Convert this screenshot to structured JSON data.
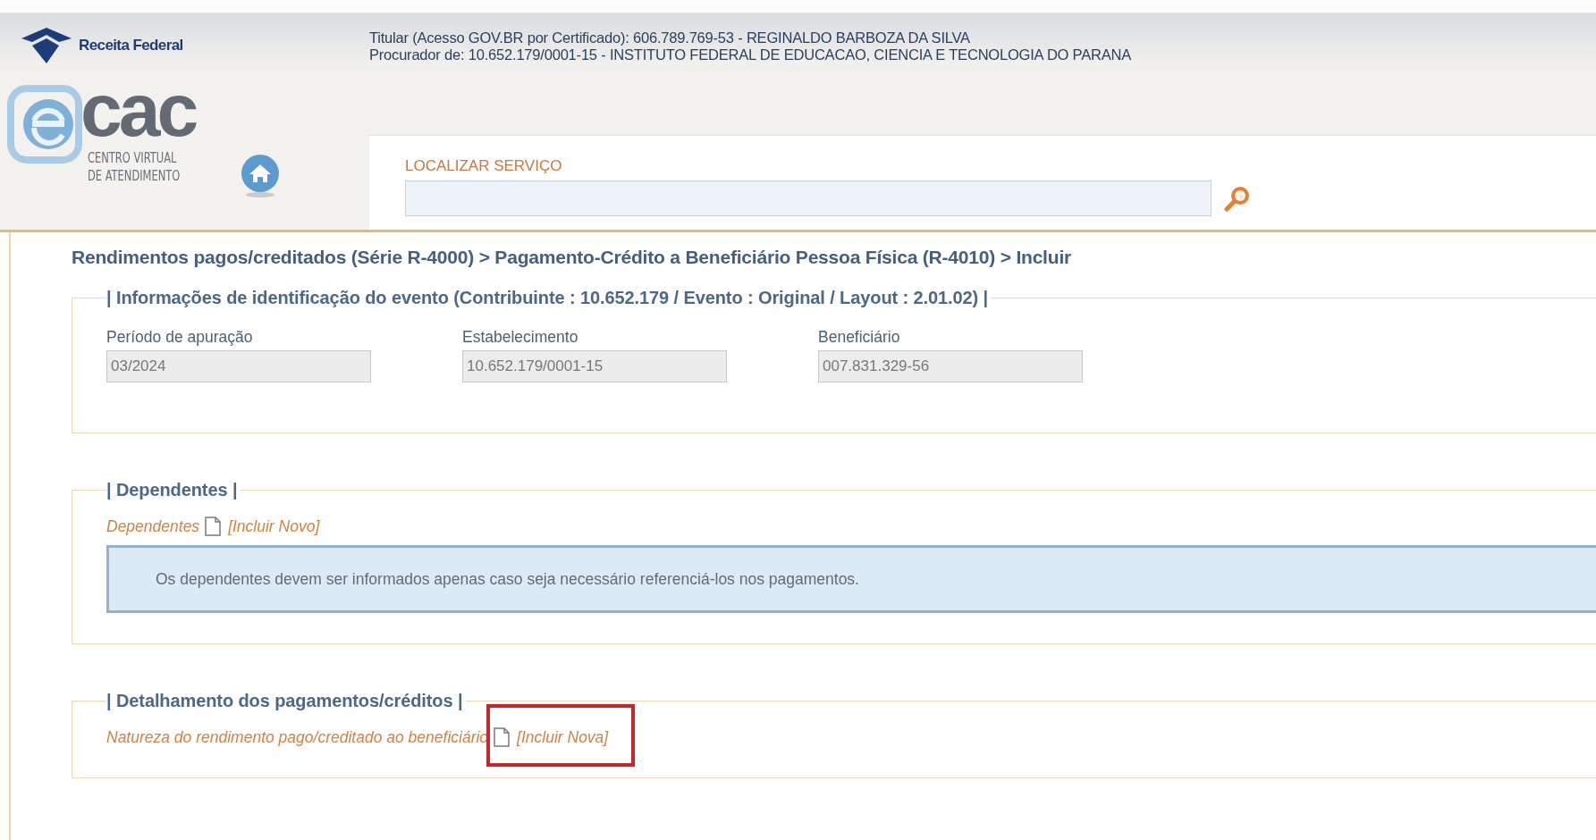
{
  "header": {
    "brand": "Receita Federal",
    "user_lines": [
      "Titular (Acesso GOV.BR por Certificado): 606.789.769-53 - REGINALDO BARBOZA DA SILVA",
      "Procurador de: 10.652.179/0001-15 - INSTITUTO FEDERAL DE EDUCACAO, CIENCIA E TECNOLOGIA DO PARANA"
    ],
    "logo_word": "cac",
    "logo_subtitle": [
      "CENTRO VIRTUAL",
      "DE ATENDIMENTO"
    ],
    "search": {
      "label": "LOCALIZAR SERVIÇO"
    }
  },
  "breadcrumb": "Rendimentos pagos/creditados (Série R-4000) > Pagamento-Crédito a Beneficiário Pessoa Física (R-4010) > Incluir",
  "sections": [
    {
      "kind": "fields",
      "legend": "| Informações de identificação do evento (Contribuinte : 10.652.179 / Evento : Original / Layout : 2.01.02) |",
      "fields": [
        {
          "label": "Período de apuração",
          "value": "03/2024"
        },
        {
          "label": "Estabelecimento",
          "value": "10.652.179/0001-15"
        },
        {
          "label": "Beneficiário",
          "value": "007.831.329-56"
        }
      ]
    },
    {
      "kind": "list",
      "legend": "| Dependentes |",
      "item_label": "Dependentes",
      "action": "[Incluir Novo]",
      "highlighted": false,
      "note": "Os dependentes devem ser informados apenas caso seja necessário referenciá-los nos pagamentos."
    },
    {
      "kind": "list",
      "legend": "| Detalhamento dos pagamentos/créditos |",
      "item_label": "Natureza do rendimento pago/creditado ao beneficiário",
      "action": "[Incluir Nova]",
      "highlighted": true
    }
  ]
}
